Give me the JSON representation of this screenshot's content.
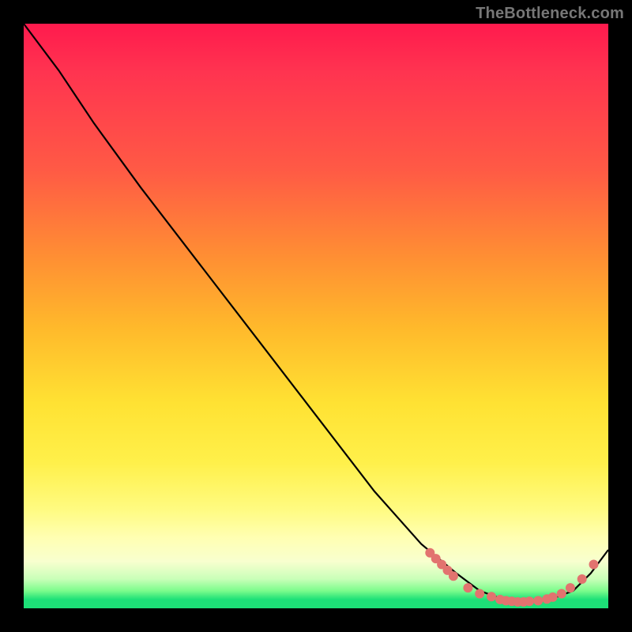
{
  "watermark": "TheBottleneck.com",
  "chart_data": {
    "type": "line",
    "title": "",
    "xlabel": "",
    "ylabel": "",
    "xlim": [
      0,
      1
    ],
    "ylim": [
      0,
      1
    ],
    "series": [
      {
        "name": "curve",
        "x": [
          0.0,
          0.06,
          0.12,
          0.2,
          0.3,
          0.4,
          0.5,
          0.6,
          0.68,
          0.74,
          0.78,
          0.82,
          0.86,
          0.9,
          0.94,
          0.97,
          1.0
        ],
        "y": [
          1.0,
          0.92,
          0.83,
          0.72,
          0.59,
          0.46,
          0.33,
          0.2,
          0.11,
          0.06,
          0.03,
          0.015,
          0.01,
          0.015,
          0.03,
          0.06,
          0.1
        ]
      }
    ],
    "markers": {
      "name": "dots",
      "x": [
        0.695,
        0.705,
        0.715,
        0.725,
        0.735,
        0.76,
        0.78,
        0.8,
        0.815,
        0.825,
        0.835,
        0.845,
        0.855,
        0.865,
        0.88,
        0.895,
        0.905,
        0.92,
        0.935,
        0.955,
        0.975
      ],
      "y": [
        0.095,
        0.085,
        0.075,
        0.065,
        0.055,
        0.035,
        0.025,
        0.02,
        0.015,
        0.013,
        0.012,
        0.011,
        0.011,
        0.012,
        0.013,
        0.016,
        0.019,
        0.025,
        0.035,
        0.05,
        0.075
      ],
      "color": "#e2736f"
    }
  }
}
